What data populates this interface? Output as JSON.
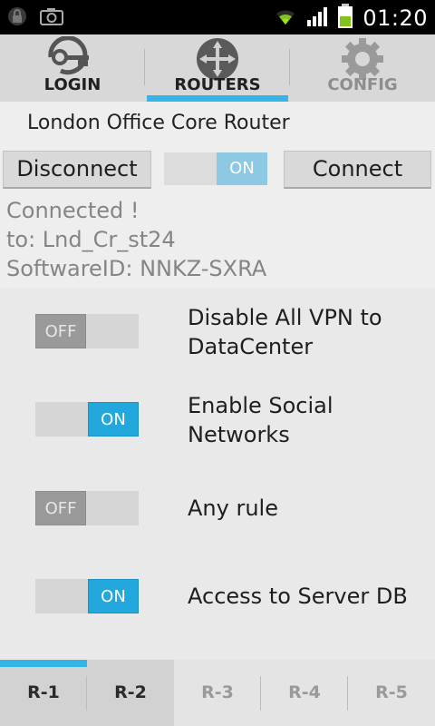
{
  "statusbar": {
    "time": "01:20",
    "icons": [
      "lock-icon",
      "camera-icon",
      "wifi-icon",
      "signal-icon",
      "battery-icon"
    ]
  },
  "top_tabs": [
    {
      "label": "LOGIN",
      "icon": "key-icon",
      "state": "normal"
    },
    {
      "label": "ROUTERS",
      "icon": "router-icon",
      "state": "selected"
    },
    {
      "label": "CONFIG",
      "icon": "gear-icon",
      "state": "disabled"
    }
  ],
  "router": {
    "title": "London Office Core Router",
    "disconnect_label": "Disconnect",
    "connect_label": "Connect",
    "connection_toggle": "ON"
  },
  "status": {
    "line1": "Connected !",
    "line2": "to: Lnd_Cr_st24",
    "line3": "SoftwareID: NNKZ-SXRA"
  },
  "rules": [
    {
      "switch": "OFF",
      "label": "Disable All VPN to DataCenter"
    },
    {
      "switch": "ON",
      "label": "Enable Social Networks"
    },
    {
      "switch": "OFF",
      "label": "Any rule"
    },
    {
      "switch": "ON",
      "label": "Access to Server DB"
    }
  ],
  "bottom_tabs": [
    {
      "label": "R-1",
      "state": "selected"
    },
    {
      "label": "R-2",
      "state": "normal"
    },
    {
      "label": "R-3",
      "state": "disabled"
    },
    {
      "label": "R-4",
      "state": "disabled"
    },
    {
      "label": "R-5",
      "state": "disabled"
    }
  ],
  "colors": {
    "accent": "#33b5e5",
    "switch_on": "#22a8dc",
    "switch_off": "#9a9a9a"
  }
}
